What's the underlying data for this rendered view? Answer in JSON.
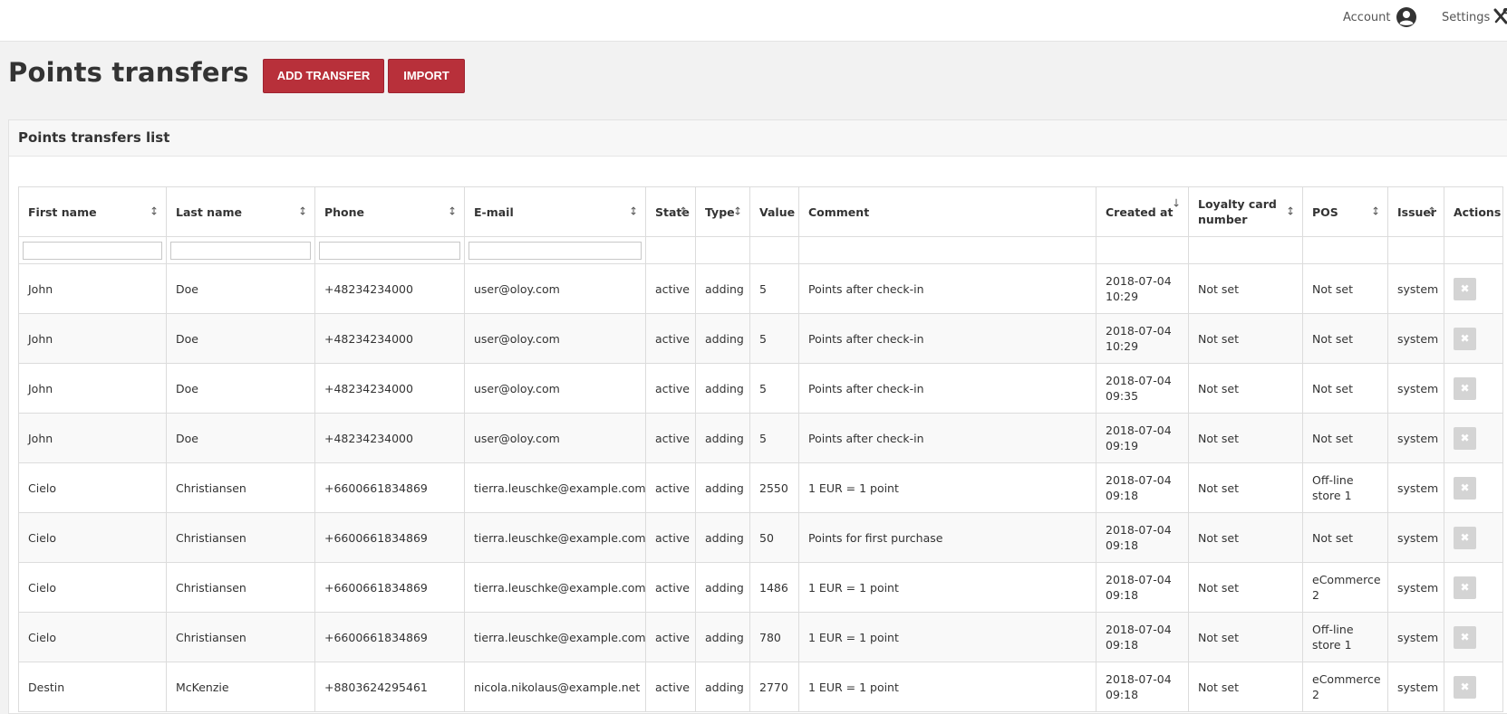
{
  "topbar": {
    "account_label": "Account",
    "account_icon": "user-circle-icon",
    "settings_label": "Settings",
    "settings_icon": "tools-icon"
  },
  "page": {
    "title": "Points transfers",
    "add_button": "ADD TRANSFER",
    "import_button": "IMPORT"
  },
  "panel": {
    "title": "Points transfers list"
  },
  "colors": {
    "accent": "#b8303a",
    "delete_button": "#d4d4d4"
  },
  "table": {
    "columns": [
      {
        "label": "First name",
        "sort": "↕",
        "filter": true
      },
      {
        "label": "Last name",
        "sort": "↕",
        "filter": true
      },
      {
        "label": "Phone",
        "sort": "↕",
        "filter": true
      },
      {
        "label": "E-mail",
        "sort": "↕",
        "filter": true
      },
      {
        "label": "State",
        "sort": "↕",
        "filter": false
      },
      {
        "label": "Type",
        "sort": "↕",
        "filter": false
      },
      {
        "label": "Value",
        "sort": "",
        "filter": false
      },
      {
        "label": "Comment",
        "sort": "",
        "filter": false
      },
      {
        "label": "Created at",
        "sort": "↓",
        "filter": false
      },
      {
        "label": "Loyalty card number",
        "sort": "↕",
        "filter": false
      },
      {
        "label": "POS",
        "sort": "↕",
        "filter": false
      },
      {
        "label": "Issuer",
        "sort": "↕",
        "filter": false
      },
      {
        "label": "Actions",
        "sort": "",
        "filter": false
      }
    ],
    "rows": [
      [
        "John",
        "Doe",
        "+48234234000",
        "user@oloy.com",
        "active",
        "adding",
        "5",
        "Points after check-in",
        "2018-07-04 10:29",
        "Not set",
        "Not set",
        "system"
      ],
      [
        "John",
        "Doe",
        "+48234234000",
        "user@oloy.com",
        "active",
        "adding",
        "5",
        "Points after check-in",
        "2018-07-04 10:29",
        "Not set",
        "Not set",
        "system"
      ],
      [
        "John",
        "Doe",
        "+48234234000",
        "user@oloy.com",
        "active",
        "adding",
        "5",
        "Points after check-in",
        "2018-07-04 09:35",
        "Not set",
        "Not set",
        "system"
      ],
      [
        "John",
        "Doe",
        "+48234234000",
        "user@oloy.com",
        "active",
        "adding",
        "5",
        "Points after check-in",
        "2018-07-04 09:19",
        "Not set",
        "Not set",
        "system"
      ],
      [
        "Cielo",
        "Christiansen",
        "+6600661834869",
        "tierra.leuschke@example.com",
        "active",
        "adding",
        "2550",
        "1 EUR = 1 point",
        "2018-07-04 09:18",
        "Not set",
        "Off-line store 1",
        "system"
      ],
      [
        "Cielo",
        "Christiansen",
        "+6600661834869",
        "tierra.leuschke@example.com",
        "active",
        "adding",
        "50",
        "Points for first purchase",
        "2018-07-04 09:18",
        "Not set",
        "Not set",
        "system"
      ],
      [
        "Cielo",
        "Christiansen",
        "+6600661834869",
        "tierra.leuschke@example.com",
        "active",
        "adding",
        "1486",
        "1 EUR = 1 point",
        "2018-07-04 09:18",
        "Not set",
        "eCommerce 2",
        "system"
      ],
      [
        "Cielo",
        "Christiansen",
        "+6600661834869",
        "tierra.leuschke@example.com",
        "active",
        "adding",
        "780",
        "1 EUR = 1 point",
        "2018-07-04 09:18",
        "Not set",
        "Off-line store 1",
        "system"
      ],
      [
        "Destin",
        "McKenzie",
        "+8803624295461",
        "nicola.nikolaus@example.net",
        "active",
        "adding",
        "2770",
        "1 EUR = 1 point",
        "2018-07-04 09:18",
        "Not set",
        "eCommerce 2",
        "system"
      ]
    ],
    "delete_glyph": "✖",
    "delete_icon": "delete-icon"
  }
}
